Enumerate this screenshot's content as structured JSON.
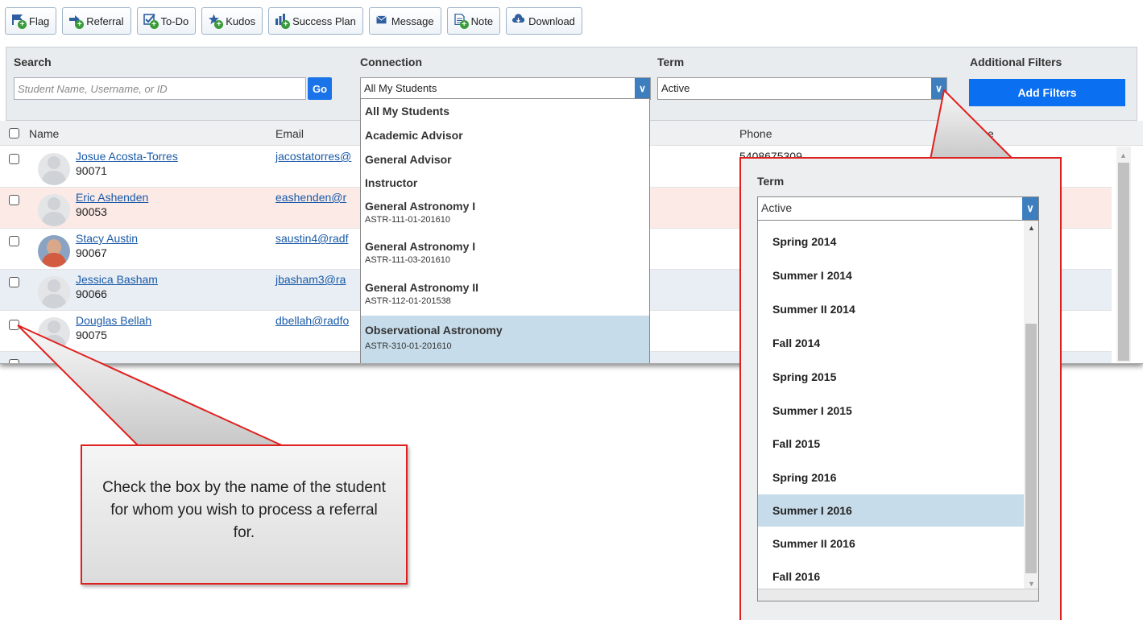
{
  "toolbar": {
    "buttons": [
      {
        "label": "Flag",
        "icon": "flag-icon"
      },
      {
        "label": "Referral",
        "icon": "referral-icon"
      },
      {
        "label": "To-Do",
        "icon": "todo-icon"
      },
      {
        "label": "Kudos",
        "icon": "kudos-icon"
      },
      {
        "label": "Success Plan",
        "icon": "success-plan-icon"
      },
      {
        "label": "Message",
        "icon": "message-icon"
      },
      {
        "label": "Note",
        "icon": "note-icon"
      },
      {
        "label": "Download",
        "icon": "download-icon"
      }
    ]
  },
  "filters": {
    "search_label": "Search",
    "search_placeholder": "Student Name, Username, or ID",
    "go_label": "Go",
    "connection_label": "Connection",
    "connection_value": "All My Students",
    "term_label": "Term",
    "term_value": "Active",
    "additional_label": "Additional Filters",
    "add_filters_label": "Add Filters"
  },
  "table": {
    "columns": {
      "name": "Name",
      "email": "Email",
      "phone": "Phone",
      "last": "e"
    },
    "rows": [
      {
        "name": "Josue Acosta-Torres",
        "id": "90071",
        "email": "jacostatorres@"
      },
      {
        "name": "Eric Ashenden",
        "id": "90053",
        "email": "eashenden@r"
      },
      {
        "name": "Stacy Austin",
        "id": "90067",
        "email": "saustin4@radf"
      },
      {
        "name": "Jessica Basham",
        "id": "90066",
        "email": "jbasham3@ra"
      },
      {
        "name": "Douglas Bellah",
        "id": "90075",
        "email": "dbellah@radfo"
      }
    ],
    "phone_partial": "5408675309"
  },
  "connection_dropdown": {
    "items": [
      {
        "title": "All My Students",
        "sub": ""
      },
      {
        "title": "Academic Advisor",
        "sub": ""
      },
      {
        "title": "General Advisor",
        "sub": ""
      },
      {
        "title": "Instructor",
        "sub": ""
      },
      {
        "title": "General Astronomy I",
        "sub": "ASTR-111-01-201610"
      },
      {
        "title": "General Astronomy I",
        "sub": "ASTR-111-03-201610"
      },
      {
        "title": "General Astronomy II",
        "sub": "ASTR-112-01-201538"
      },
      {
        "title": "Observational Astronomy",
        "sub": "ASTR-310-01-201610"
      }
    ],
    "selected_index": 7
  },
  "term_zoom": {
    "label": "Term",
    "value": "Active",
    "items": [
      "Spring 2014",
      "Summer I 2014",
      "Summer II 2014",
      "Fall 2014",
      "Spring 2015",
      "Summer I 2015",
      "Fall 2015",
      "Spring 2016",
      "Summer I 2016",
      "Summer II 2016",
      "Fall 2016"
    ],
    "selected_index": 8
  },
  "callout": {
    "text": "Check the box by the name of the student for whom you wish to process a referral for."
  },
  "colors": {
    "accent": "#1a73e8",
    "callout_border": "#e0201e",
    "selected": "#c7dcea"
  }
}
